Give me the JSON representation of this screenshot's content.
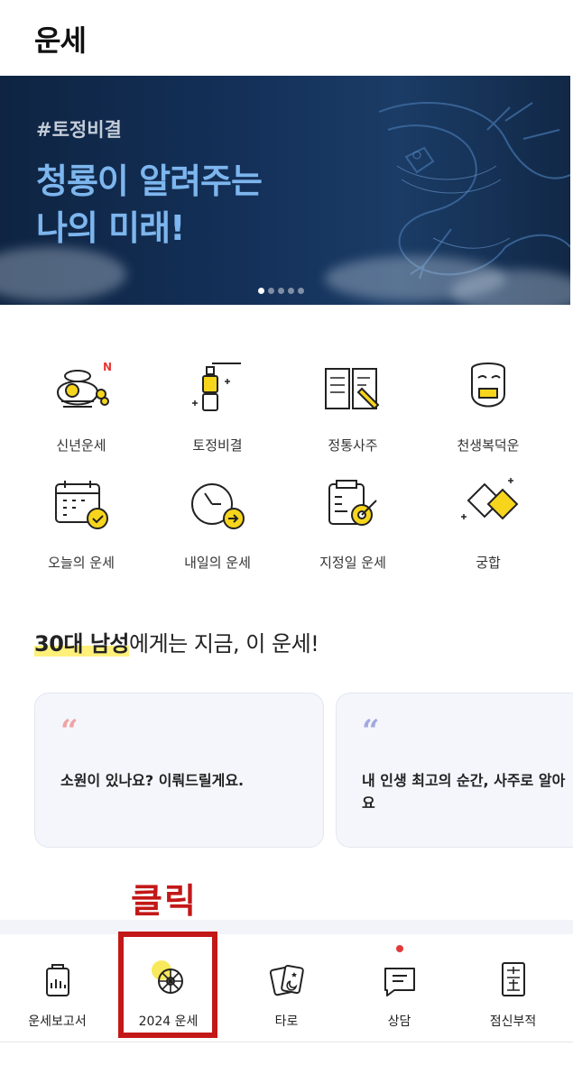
{
  "header": {
    "title": "운세"
  },
  "banner": {
    "tag": "#토정비결",
    "line1": "청룡이 알려주는",
    "line2": "나의 미래!",
    "page_count": 5,
    "active_page": 1
  },
  "services": [
    {
      "label": "신년운세",
      "badge": "N"
    },
    {
      "label": "토정비결"
    },
    {
      "label": "정통사주"
    },
    {
      "label": "천생복덕운"
    },
    {
      "label": "오늘의 운세"
    },
    {
      "label": "내일의 운세"
    },
    {
      "label": "지정일 운세"
    },
    {
      "label": "궁합"
    }
  ],
  "recommend": {
    "highlight": "30대 남성",
    "rest": "에게는 지금, 이 운세!"
  },
  "cards": [
    {
      "quote": "“",
      "text_lines": [
        "소원이 있나요? 이뤄드릴게요."
      ],
      "quote_color": "#f0a2a2"
    },
    {
      "quote": "“",
      "text_lines": [
        "내 인생 최고의 순간, 사주로 알아",
        "요"
      ],
      "quote_color": "#a4a8e0"
    }
  ],
  "annotation": {
    "label": "클릭",
    "color": "#c31818"
  },
  "tabbar": {
    "tabs": [
      {
        "label": "운세보고서"
      },
      {
        "label": "2024 운세"
      },
      {
        "label": "타로"
      },
      {
        "label": "상담",
        "has_notification": true
      },
      {
        "label": "점신부적"
      }
    ]
  },
  "colors": {
    "accent_yellow": "#f7d51c",
    "banner_text": "#7db6ee",
    "annotation_red": "#c31818"
  }
}
